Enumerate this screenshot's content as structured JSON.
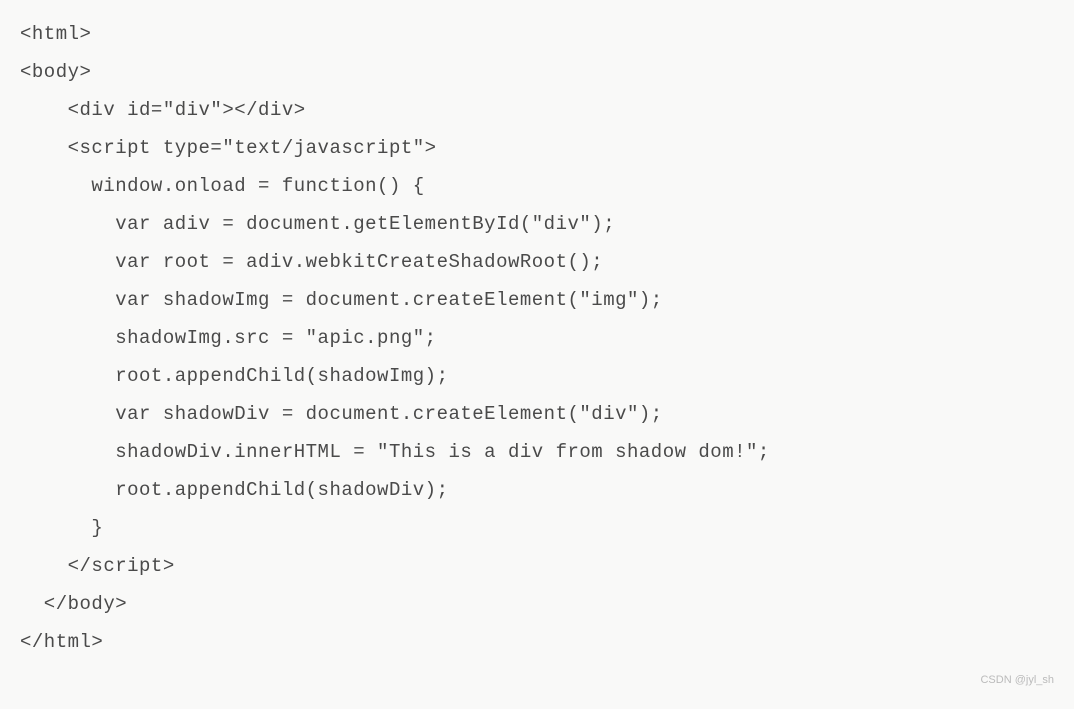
{
  "code": {
    "lines": [
      "<html>",
      "<body>",
      "    <div id=\"div\"></div>",
      "    <script type=\"text/javascript\">",
      "      window.onload = function() {",
      "        var adiv = document.getElementById(\"div\");",
      "        var root = adiv.webkitCreateShadowRoot();",
      "        var shadowImg = document.createElement(\"img\");",
      "        shadowImg.src = \"apic.png\";",
      "        root.appendChild(shadowImg);",
      "        var shadowDiv = document.createElement(\"div\");",
      "        shadowDiv.innerHTML = \"This is a div from shadow dom!\";",
      "        root.appendChild(shadowDiv);",
      "      }",
      "    </script>",
      "  </body>",
      "</html>"
    ]
  },
  "watermark": "CSDN @jyl_sh"
}
